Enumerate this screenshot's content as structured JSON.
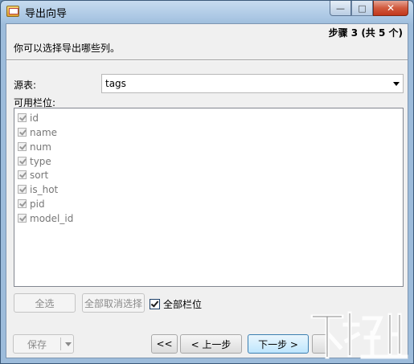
{
  "window": {
    "title": "导出向导",
    "minimize_glyph": "—",
    "maximize_glyph": "□",
    "close_glyph": "✕"
  },
  "header": {
    "step": "步骤 3 (共 5 个)",
    "instruction": "你可以选择导出哪些列。"
  },
  "source": {
    "label": "源表:",
    "value": "tags"
  },
  "fields": {
    "label": "可用栏位:",
    "items": [
      {
        "label": "id",
        "checked": true
      },
      {
        "label": "name",
        "checked": true
      },
      {
        "label": "num",
        "checked": true
      },
      {
        "label": "type",
        "checked": true
      },
      {
        "label": "sort",
        "checked": true
      },
      {
        "label": "is_hot",
        "checked": true
      },
      {
        "label": "pid",
        "checked": true
      },
      {
        "label": "model_id",
        "checked": true
      }
    ]
  },
  "buttons": {
    "select_all": "全选",
    "deselect_all": "全部取消选择",
    "all_columns": "全部栏位",
    "all_columns_checked": true,
    "save": "保存",
    "first": "<<",
    "prev": "< 上一步",
    "next": "下一步 >"
  },
  "colors": {
    "title_bar": "#9dbcdb",
    "close_button": "#c2371b",
    "dialog_bg": "#f0f0f0"
  }
}
